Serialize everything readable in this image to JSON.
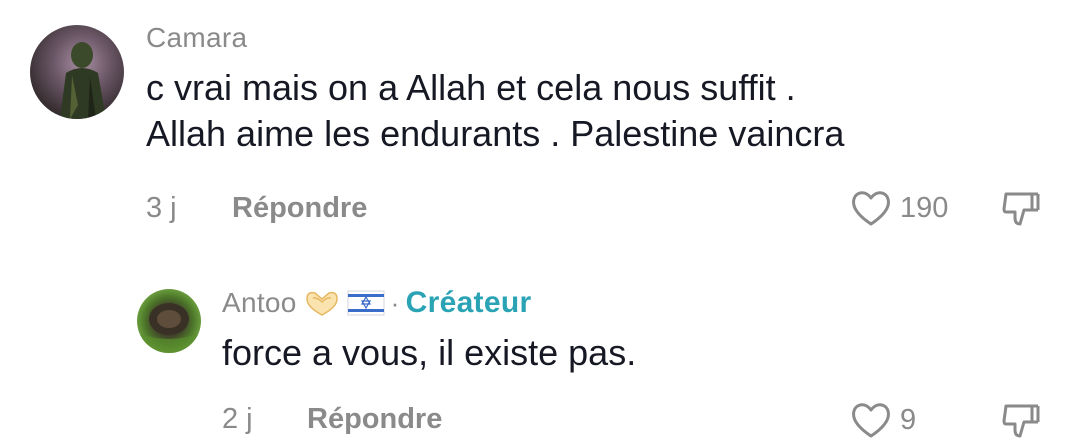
{
  "comments": [
    {
      "username": "Camara",
      "text_line1": "c vrai mais on a Allah et cela nous suffit .",
      "text_line2": "Allah aime les endurants . Palestine vaincra",
      "time": "3 j",
      "reply_label": "Répondre",
      "likes": "190",
      "avatar_icon": "person-icon"
    },
    {
      "username": "Antoo",
      "emojis": [
        "heart-hands-emoji",
        "israel-flag-emoji"
      ],
      "separator": "·",
      "badge": "Créateur",
      "badge_color": "#2aa3b4",
      "text": "force a vous, il existe pas.",
      "time": "2 j",
      "reply_label": "Répondre",
      "likes": "9",
      "avatar_icon": "landscape-icon"
    }
  ],
  "colors": {
    "text_primary": "#161823",
    "text_secondary": "#8a8a8a",
    "background": "#ffffff"
  },
  "icons": {
    "like": "heart-outline-icon",
    "dislike": "thumbs-down-outline-icon"
  }
}
